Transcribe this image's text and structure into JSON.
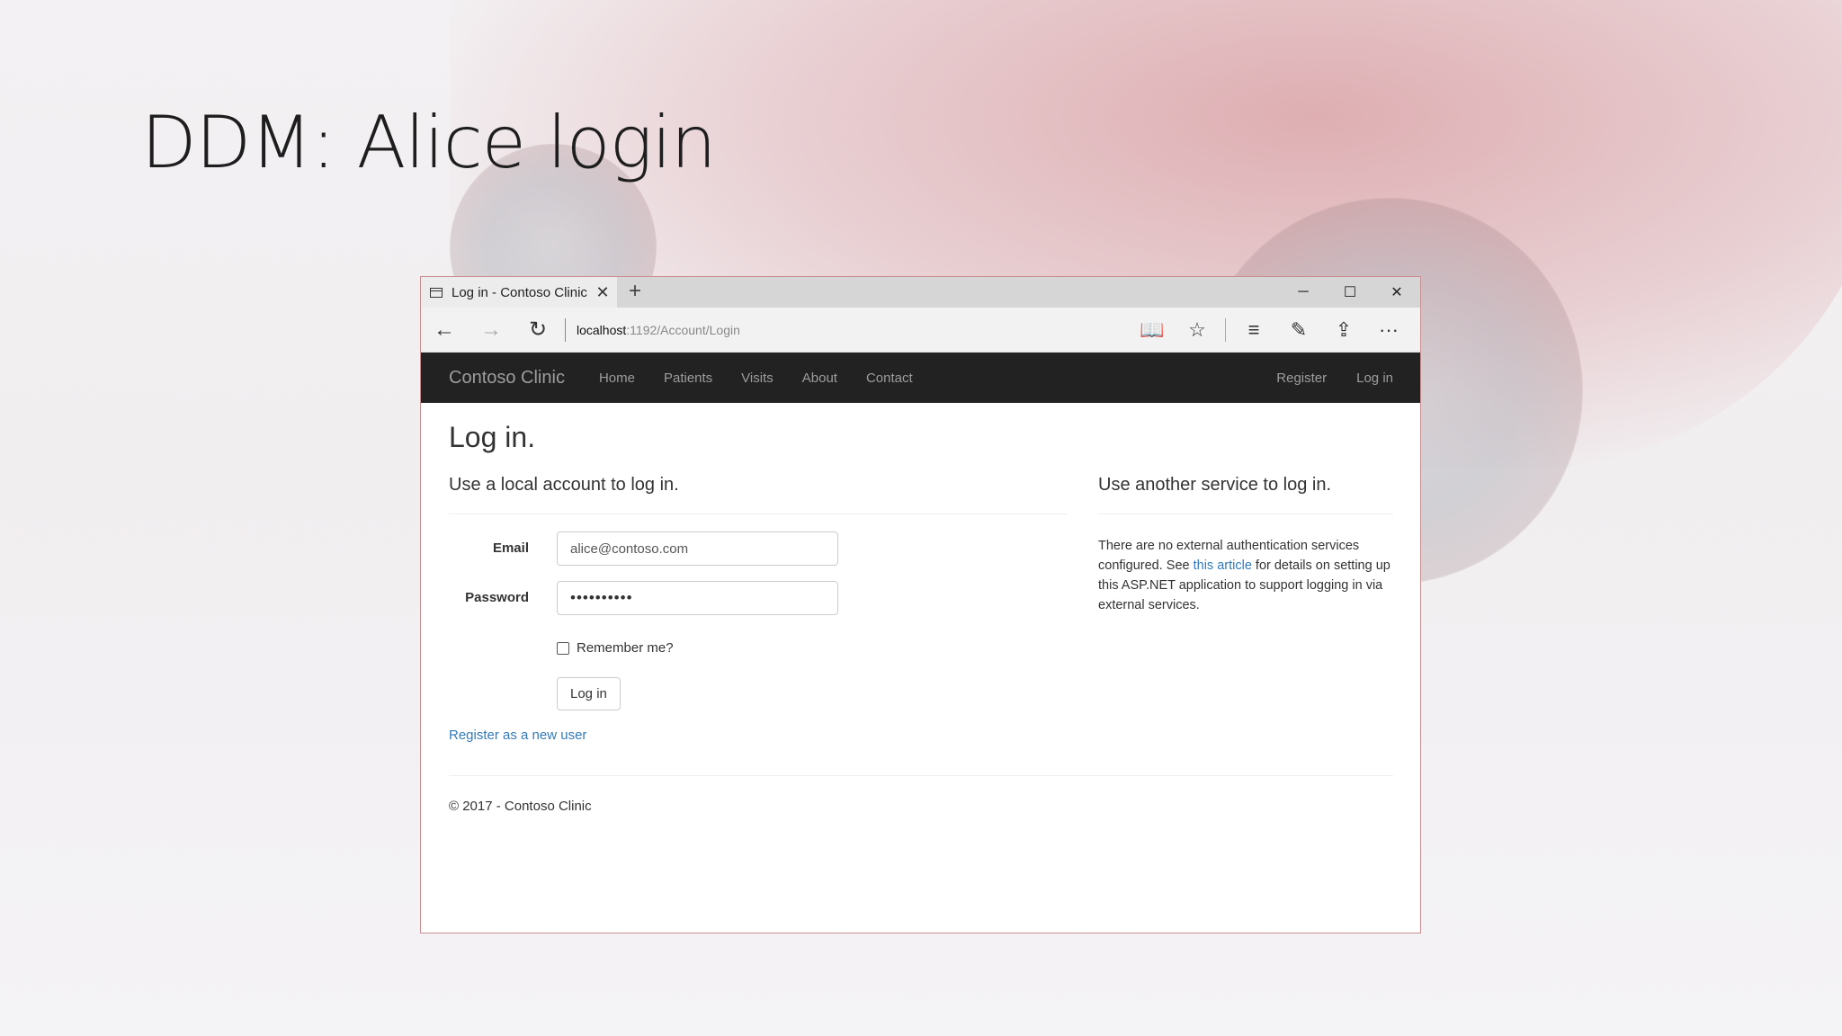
{
  "slide": {
    "title": "DDM: Alice login"
  },
  "browser": {
    "tab_title": "Log in - Contoso Clinic",
    "tab_close": "✕",
    "new_tab": "+",
    "minimize": "─",
    "maximize": "☐",
    "close": "✕",
    "back": "←",
    "forward": "→",
    "refresh": "↻",
    "url_host": "localhost",
    "url_path": ":1192/Account/Login",
    "reading_view": "📖",
    "favorite": "☆",
    "hub": "≡",
    "notes": "✎",
    "share": "⇪",
    "more": "···"
  },
  "site_nav": {
    "brand": "Contoso Clinic",
    "links": [
      "Home",
      "Patients",
      "Visits",
      "About",
      "Contact"
    ],
    "register": "Register",
    "login": "Log in"
  },
  "page": {
    "heading": "Log in.",
    "local_heading": "Use a local account to log in.",
    "email_label": "Email",
    "email_value": "alice@contoso.com",
    "password_label": "Password",
    "password_value": "••••••••••",
    "remember_label": "Remember me?",
    "login_button": "Log in",
    "register_link": "Register as a new user",
    "external_heading": "Use another service to log in.",
    "external_text_1": "There are no external authentication services configured. See ",
    "external_link": "this article",
    "external_text_2": " for details on setting up this ASP.NET application to support logging in via external services.",
    "footer": "© 2017 - Contoso Clinic"
  }
}
